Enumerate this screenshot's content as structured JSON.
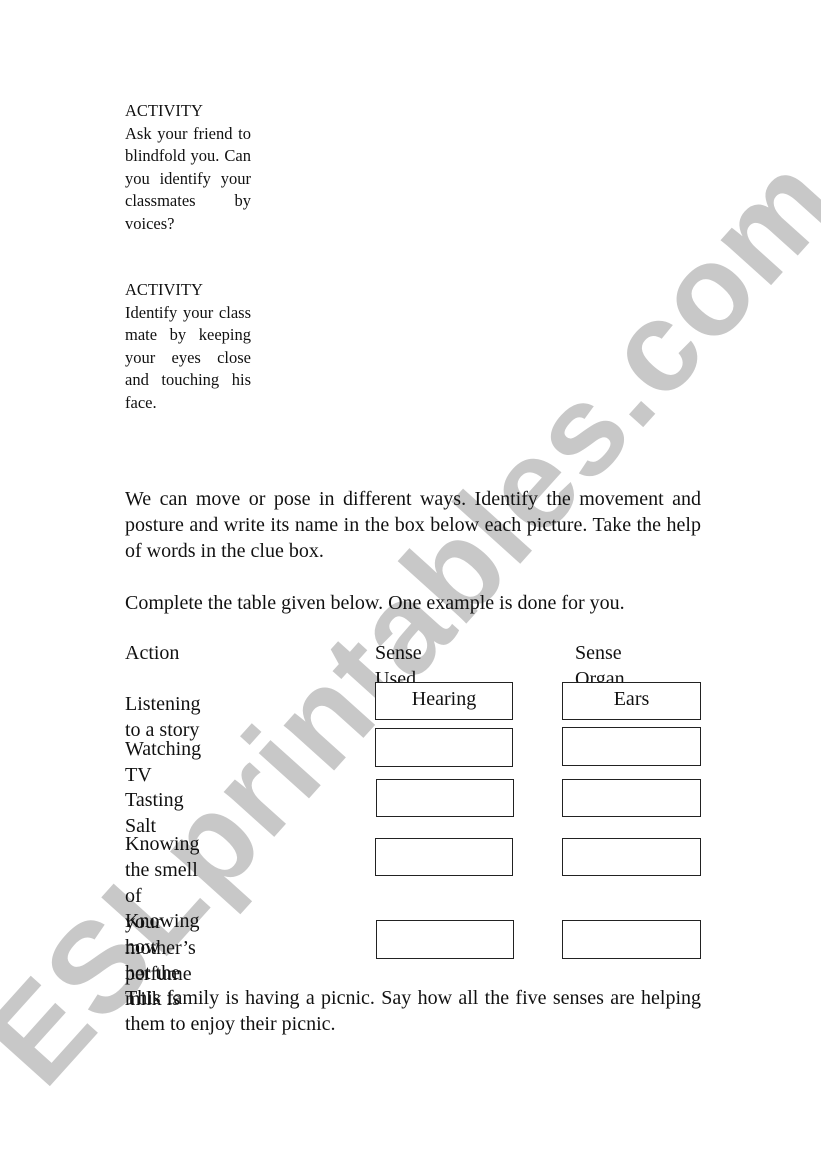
{
  "watermark": "ESLprintables.com",
  "activities": [
    {
      "heading": "ACTIVITY",
      "text": "Ask your friend to blindfold you. Can you identify your classmates by voices?"
    },
    {
      "heading": "ACTIVITY",
      "text": "Identify your class mate by keeping your eyes close and touching his face."
    }
  ],
  "paragraphs": {
    "movement": "We can move or pose in different ways. Identify the movement and posture and write its name in the box below each picture. Take the help of words in the clue box.",
    "instruction": "Complete the table given below. One example is done for you.",
    "picnic": "This family is having a picnic. Say how all the five senses are helping them to enjoy their picnic."
  },
  "table": {
    "headers": [
      "Action",
      "Sense Used",
      "Sense Organ"
    ],
    "rows": [
      {
        "action_line1": "Listening to a story",
        "action_line2": "",
        "sense_used": "Hearing",
        "sense_organ": "Ears"
      },
      {
        "action_line1": "Watching TV",
        "action_line2": "",
        "sense_used": "",
        "sense_organ": ""
      },
      {
        "action_line1": "Tasting Salt",
        "action_line2": "",
        "sense_used": "",
        "sense_organ": ""
      },
      {
        "action_line1": "Knowing the smell of",
        "action_line2": "your mother’s perfume",
        "sense_used": "",
        "sense_organ": ""
      },
      {
        "action_line1": "Knowing how",
        "action_line2": "hot the milk is",
        "sense_used": "",
        "sense_organ": ""
      }
    ]
  }
}
